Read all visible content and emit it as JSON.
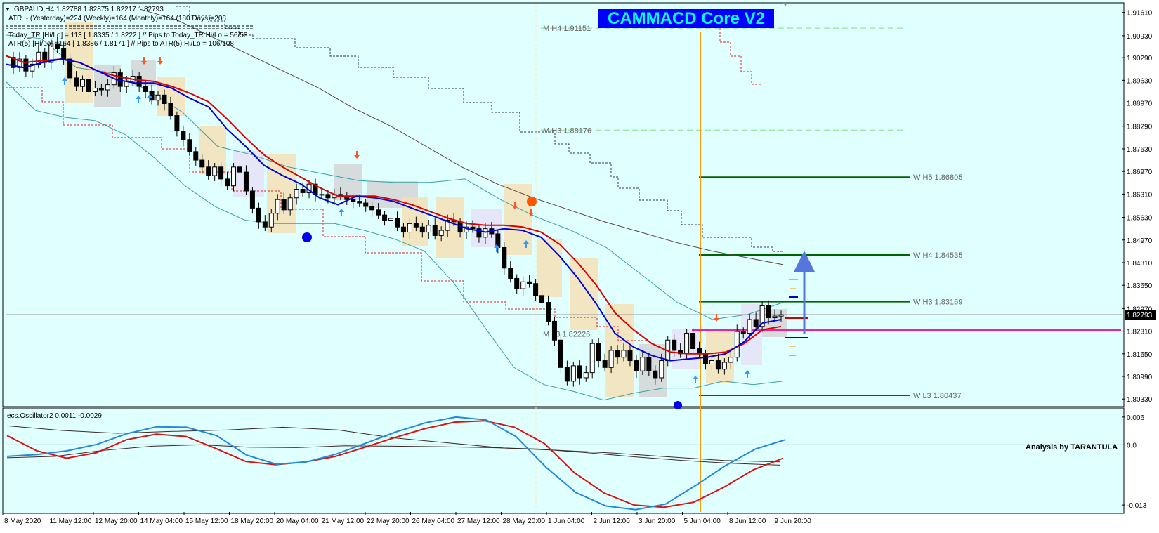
{
  "colors": {
    "background": "#e0ffff",
    "axis_panel": "#ffffff",
    "bull_body": "#ffffff",
    "bear_body": "#000000",
    "ema_fast": "#0000dd",
    "ema_slow": "#dd0000",
    "sma_long": "#5a4040",
    "bands": "#3aa0a8",
    "trail_dark": "#303060",
    "trail_red": "#dd2020",
    "vline": "#ff9900",
    "pivot_dashed": "#88dd88",
    "pivot_w_green": "#006400",
    "pivot_w_red": "#cc0000",
    "magenta": "#ee2299",
    "arrow_blue": "#5577dd",
    "banner_bg": "#0000ff",
    "banner_text": "#00ffff",
    "osc_red": "#dd1111",
    "osc_blue": "#2288dd",
    "osc_dark": "#3a2a2a"
  },
  "header": {
    "symbol_line": "GBPAUD,H4  1.82788 1.82875 1.82217 1.82793",
    "atr_line": "ATR :- (Yesterday)=224      (Weekly)=164      (Monthly)=164      (180 Days)=208",
    "today_line": "Today_TR [Hi/Lo] = 113 [ 1.8335 / 1.8222 ]   // Pips to Today_TR Hi/Lo   = 56/58",
    "atr5_line": "ATR(5)     [Hi/Lo] =164 [ 1.8386 / 1.8171 ]   //   Pips to ATR(5) Hi/Lo      = 106/108"
  },
  "banner": {
    "text": "CAMMACD Core V2"
  },
  "current_price": "1.82793",
  "osc_label": "ecs.Oscillator2 0.0011 -0.0029",
  "credit": "Analysis by TARANTULA",
  "pivot_labels": [
    {
      "text": "M  H4 1.91151",
      "value": 1.91151,
      "kind": "monthly"
    },
    {
      "text": "M  H3 1.88176",
      "value": 1.88176,
      "kind": "monthly"
    },
    {
      "text": "M  L3 1.82226",
      "value": 1.82226,
      "kind": "monthly"
    },
    {
      "text": "W  H5 1.86805",
      "value": 1.86805,
      "kind": "weekly_green"
    },
    {
      "text": "W  H4 1.84535",
      "value": 1.84535,
      "kind": "weekly_green"
    },
    {
      "text": "W  H3 1.83169",
      "value": 1.83169,
      "kind": "weekly_green"
    },
    {
      "text": "W  L3 1.80437",
      "value": 1.80437,
      "kind": "weekly_red"
    }
  ],
  "chart_data": [
    {
      "type": "candlestick",
      "title": "GBPAUD,H4",
      "ylim": [
        1.8015,
        1.9185
      ],
      "y_ticks": [
        "1.91610",
        "1.90930",
        "1.90290",
        "1.89630",
        "1.88970",
        "1.88290",
        "1.87630",
        "1.86970",
        "1.86310",
        "1.85630",
        "1.84970",
        "1.84310",
        "1.83650",
        "1.82970",
        "1.82310",
        "1.81650",
        "1.80990",
        "1.80330"
      ],
      "x_ticks": [
        "8 May 2020",
        "11 May 12:00",
        "12 May 20:00",
        "14 May 04:00",
        "15 May 12:00",
        "18 May 20:00",
        "20 May 04:00",
        "21 May 12:00",
        "22 May 20:00",
        "26 May 04:00",
        "27 May 12:00",
        "28 May 20:00",
        "1 Jun 04:00",
        "2 Jun 12:00",
        "3 Jun 20:00",
        "5 Jun 04:00",
        "8 Jun 12:00",
        "9 Jun 20:00"
      ],
      "close_path": [
        1.903,
        1.9,
        1.9025,
        1.899,
        1.901,
        1.9045,
        1.9015,
        1.907,
        1.9055,
        1.9025,
        1.897,
        1.8945,
        1.8965,
        1.893,
        1.894,
        1.8935,
        1.895,
        1.8985,
        1.8945,
        1.896,
        1.8975,
        1.8945,
        1.893,
        1.8905,
        1.892,
        1.8895,
        1.886,
        1.8815,
        1.879,
        1.8755,
        1.873,
        1.871,
        1.8685,
        1.871,
        1.8675,
        1.8655,
        1.871,
        1.8695,
        1.864,
        1.859,
        1.855,
        1.8535,
        1.8575,
        1.8615,
        1.8585,
        1.862,
        1.8645,
        1.8635,
        1.866,
        1.863,
        1.863,
        1.862,
        1.863,
        1.8625,
        1.8615,
        1.861,
        1.8605,
        1.8595,
        1.8585,
        1.857,
        1.8555,
        1.856,
        1.8535,
        1.852,
        1.8545,
        1.8535,
        1.852,
        1.854,
        1.851,
        1.8525,
        1.8555,
        1.855,
        1.852,
        1.8535,
        1.853,
        1.8505,
        1.853,
        1.8515,
        1.8475,
        1.8415,
        1.8385,
        1.8355,
        1.8375,
        1.837,
        1.8335,
        1.8315,
        1.826,
        1.8205,
        1.8125,
        1.8085,
        1.813,
        1.8095,
        1.811,
        1.8195,
        1.8145,
        1.8125,
        1.8175,
        1.8155,
        1.8175,
        1.8145,
        1.8115,
        1.8155,
        1.8115,
        1.8095,
        1.8145,
        1.8205,
        1.8175,
        1.8165,
        1.8225,
        1.818,
        1.8165,
        1.8135,
        1.8145,
        1.812,
        1.814,
        1.8155,
        1.823,
        1.8225,
        1.8265,
        1.8245,
        1.8305,
        1.827,
        1.8275,
        1.8279
      ],
      "series": [
        {
          "name": "EMA fast",
          "values": [
            1.901,
            1.9,
            1.9015,
            1.9025,
            1.9015,
            1.899,
            1.8965,
            1.8955,
            1.8955,
            1.894,
            1.891,
            1.8885,
            1.882,
            1.877,
            1.8715,
            1.8685,
            1.866,
            1.862,
            1.86,
            1.8625,
            1.862,
            1.861,
            1.859,
            1.857,
            1.855,
            1.853,
            1.852,
            1.853,
            1.8525,
            1.8505,
            1.845,
            1.8385,
            1.831,
            1.8225,
            1.8185,
            1.816,
            1.8145,
            1.815,
            1.8155,
            1.8165,
            1.82,
            1.8255,
            1.8265
          ]
        },
        {
          "name": "EMA slow",
          "values": [
            1.9035,
            1.9015,
            1.902,
            1.9025,
            1.9015,
            1.899,
            1.8975,
            1.8965,
            1.896,
            1.8945,
            1.8925,
            1.89,
            1.885,
            1.8795,
            1.8745,
            1.871,
            1.868,
            1.865,
            1.8625,
            1.8625,
            1.8625,
            1.8615,
            1.86,
            1.858,
            1.856,
            1.8545,
            1.854,
            1.854,
            1.8535,
            1.852,
            1.8485,
            1.843,
            1.8365,
            1.8285,
            1.8235,
            1.8195,
            1.817,
            1.8165,
            1.8165,
            1.817,
            1.8195,
            1.8235,
            1.8245
          ]
        },
        {
          "name": "SMA long",
          "values": [
            1.917,
            1.914,
            1.909,
            1.904,
            1.899,
            1.894,
            1.888,
            1.883,
            1.877,
            1.871,
            1.866,
            1.862,
            1.8585,
            1.855,
            1.852,
            1.849,
            1.8465,
            1.8445,
            1.8425
          ]
        },
        {
          "name": "Band upper",
          "values": [
            1.9095,
            1.9085,
            1.9,
            1.8985,
            1.8935,
            1.887,
            1.877,
            1.8745,
            1.871,
            1.869,
            1.867,
            1.8665,
            1.8665,
            1.8675,
            1.8615,
            1.8565,
            1.8525,
            1.8475,
            1.8395,
            1.8315,
            1.8265,
            1.828,
            1.8315
          ]
        },
        {
          "name": "Band lower",
          "values": [
            1.896,
            1.8875,
            1.8855,
            1.8845,
            1.8805,
            1.8735,
            1.8655,
            1.8595,
            1.8555,
            1.8545,
            1.8545,
            1.8545,
            1.8525,
            1.85,
            1.8465,
            1.837,
            1.8245,
            1.8125,
            1.8075,
            1.8055,
            1.803,
            1.805,
            1.8065,
            1.8065,
            1.8085,
            1.8075,
            1.8085
          ]
        }
      ],
      "background_grid": false
    },
    {
      "type": "line",
      "title": "ecs.Oscillator2 0.0011 -0.0029",
      "ylim": [
        -0.0145,
        0.0075
      ],
      "y_ticks": [
        "0.006",
        "0.0",
        "-0.013"
      ],
      "series": [
        {
          "name": "blue",
          "values": [
            -0.0025,
            -0.0021,
            -0.0013,
            0.0001,
            0.0024,
            0.0039,
            0.0038,
            0.002,
            -0.0022,
            -0.0042,
            -0.0037,
            -0.002,
            0.0004,
            0.0028,
            0.0048,
            0.006,
            0.0054,
            0.0018,
            -0.0048,
            -0.0103,
            -0.0132,
            -0.014,
            -0.0128,
            -0.0088,
            -0.0045,
            -0.0009,
            0.0011
          ]
        },
        {
          "name": "red",
          "values": [
            0.002,
            -0.0013,
            -0.0029,
            -0.0017,
            0.0011,
            0.0023,
            0.0018,
            -0.0008,
            -0.0036,
            -0.0043,
            -0.0037,
            -0.0025,
            -0.0005,
            0.0016,
            0.0035,
            0.0049,
            0.0052,
            0.0038,
            0.0003,
            -0.006,
            -0.0104,
            -0.013,
            -0.0135,
            -0.0124,
            -0.0092,
            -0.0054,
            -0.0029
          ]
        },
        {
          "name": "dark1",
          "values": [
            0.0041,
            0.0031,
            0.0025,
            0.0029,
            0.0032,
            0.0038,
            0.0032,
            0.0015,
            0.0004,
            -0.0007,
            -0.0012,
            -0.0018,
            -0.0026,
            -0.0034,
            -0.0037
          ]
        },
        {
          "name": "dark2",
          "values": [
            -0.0028,
            -0.0025,
            -0.0012,
            -0.0003,
            0.0,
            -0.0005,
            -0.0006,
            -0.0002,
            -0.0003,
            -0.0004,
            -0.0006,
            -0.0009,
            -0.0017,
            -0.0026,
            -0.0034,
            -0.004,
            -0.0044
          ]
        }
      ]
    }
  ]
}
